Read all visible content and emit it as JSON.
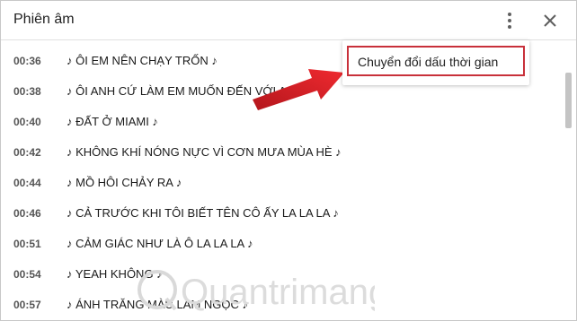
{
  "header": {
    "title": "Phiên âm",
    "more_icon": "more-vertical-icon",
    "close_icon": "close-icon"
  },
  "transcript": [
    {
      "time": "00:36",
      "text": "♪ ÔI EM NÊN CHẠY TRỐN ♪"
    },
    {
      "time": "00:38",
      "text": "♪ ÔI ANH CỨ LÀM EM MUỐN ĐẾN VỚI A"
    },
    {
      "time": "00:40",
      "text": "♪ ĐẤT Ở MIAMI ♪"
    },
    {
      "time": "00:42",
      "text": "♪ KHÔNG KHÍ NÓNG NỰC VÌ CƠN MƯA MÙA HÈ ♪"
    },
    {
      "time": "00:44",
      "text": "♪ MỒ HÔI CHẢY RA ♪"
    },
    {
      "time": "00:46",
      "text": "♪ CẢ TRƯỚC KHI TÔI BIẾT TÊN CÔ ẤY LA LA LA ♪"
    },
    {
      "time": "00:51",
      "text": "♪ CẢM GIÁC NHƯ LÀ Ô LA LA LA ♪"
    },
    {
      "time": "00:54",
      "text": "♪ YEAH KHÔNG ♪"
    },
    {
      "time": "00:57",
      "text": "♪ ÁNH TRĂNG MÀU LAM NGỌC ♪"
    }
  ],
  "menu": {
    "item_label": "Chuyển đổi dấu thời gian"
  },
  "annotation": {
    "arrow_color": "#e0242b",
    "highlight_color": "#c8303a"
  },
  "watermark": {
    "text": "Quantrimang",
    "color": "#d8d8d8"
  }
}
